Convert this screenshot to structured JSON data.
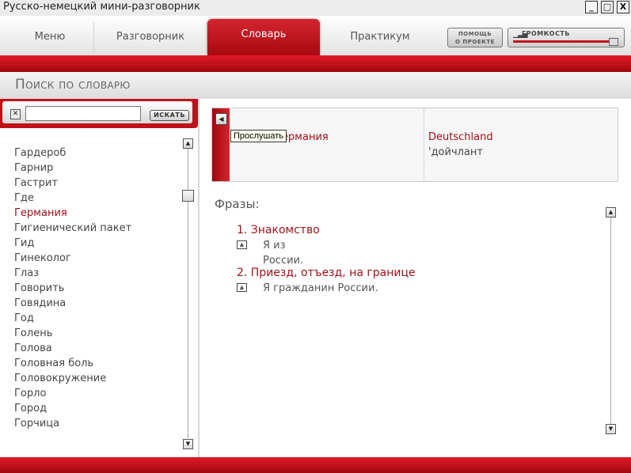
{
  "window": {
    "title": "Русско-немецкий мини-разговорник",
    "minimize": "_",
    "maximize": "□",
    "close": "X"
  },
  "nav": {
    "tabs": [
      "Меню",
      "Разговорник",
      "Словарь",
      "Практикум"
    ],
    "active_tab": "Словарь",
    "help_line1": "ПОМОЩЬ",
    "help_line2": "О ПРОЕКТЕ",
    "volume_label": "ГРОМКОСТЬ",
    "volume_level": 0.95
  },
  "section": {
    "title": "Поиск по словарю"
  },
  "search": {
    "value": "",
    "placeholder": "",
    "button": "ИСКАТЬ",
    "clear": "✕"
  },
  "wordlist": {
    "items": [
      "Гардероб",
      "Гарнир",
      "Гастрит",
      "Где",
      "Германия",
      "Гигиенический пакет",
      "Гид",
      "Гинеколог",
      "Глаз",
      "Говорить",
      "Говядина",
      "Год",
      "Голень",
      "Голова",
      "Головная боль",
      "Головокружение",
      "Горло",
      "Город",
      "Горчица"
    ],
    "selected": "Германия"
  },
  "entry": {
    "russian": "Германия",
    "german": "Deutschland",
    "transliteration": "'дойчлант",
    "tooltip": "Прослушать"
  },
  "phrases": {
    "title": "Фразы:",
    "groups": [
      {
        "title": "1. Знакомство",
        "items": [
          "Я из России."
        ]
      },
      {
        "title": "2. Приезд, отъезд, на границе",
        "items": [
          "Я гражданин России."
        ]
      }
    ]
  },
  "colors": {
    "accent": "#c0101a",
    "selected_text": "#a01018"
  }
}
